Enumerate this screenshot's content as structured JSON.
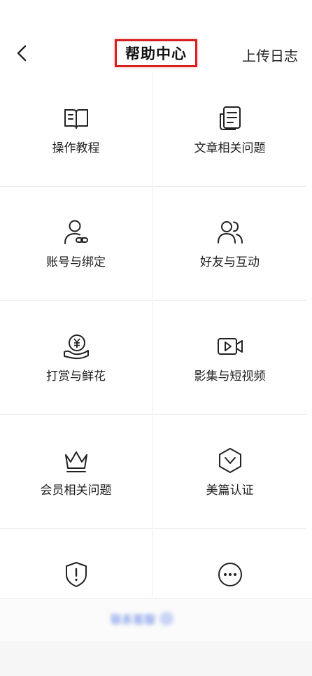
{
  "header": {
    "title": "帮助中心",
    "upload_log_label": "上传日志"
  },
  "categories": [
    {
      "label": "操作教程",
      "icon": "tutorial-book-icon"
    },
    {
      "label": "文章相关问题",
      "icon": "article-doc-icon"
    },
    {
      "label": "账号与绑定",
      "icon": "account-link-icon"
    },
    {
      "label": "好友与互动",
      "icon": "friends-icon"
    },
    {
      "label": "打赏与鲜花",
      "icon": "yen-hand-icon"
    },
    {
      "label": "影集与短视频",
      "icon": "video-camera-icon"
    },
    {
      "label": "会员相关问题",
      "icon": "crown-icon"
    },
    {
      "label": "美篇认证",
      "icon": "hexagon-check-icon"
    },
    {
      "label": "",
      "icon": "shield-alert-icon"
    },
    {
      "label": "",
      "icon": "more-dots-icon"
    }
  ],
  "bottom": {
    "contact_label": "联系客服"
  },
  "colors": {
    "title_highlight": "#d62020",
    "contact_blue": "#5b7fe6"
  }
}
